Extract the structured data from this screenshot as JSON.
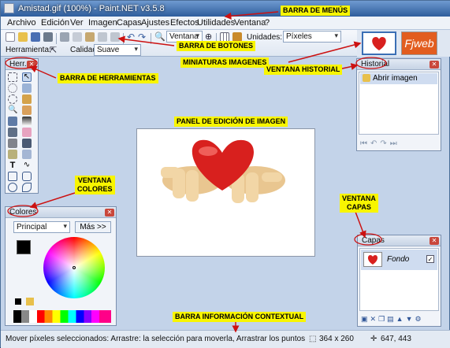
{
  "window": {
    "title": "Amistad.gif (100%) - Paint.NET v3.5.8"
  },
  "menu": [
    "Archivo",
    "Edición",
    "Ver",
    "Imagen",
    "Capas",
    "Ajustes",
    "Efectos",
    "Utilidades",
    "Ventana",
    "?"
  ],
  "toolbar": {
    "zoom_value": "Ventana",
    "units_label": "Unidades:",
    "units_value": "Píxeles",
    "tool_label": "Herramienta:",
    "quality_label": "Calidad:",
    "quality_value": "Suave"
  },
  "thumbnails": {
    "second_label": "Fjweb"
  },
  "tools_panel": {
    "title": "Herr..."
  },
  "history_panel": {
    "title": "Historial",
    "items": [
      "Abrir imagen"
    ]
  },
  "colors_panel": {
    "title": "Colores",
    "palette_select": "Principal",
    "more_button": "Más >>"
  },
  "layers_panel": {
    "title": "Capas",
    "items": [
      {
        "name": "Fondo",
        "visible": true
      }
    ]
  },
  "status": {
    "message": "Mover píxeles seleccionados: Arrastre: la selección para moverla, Arrastrar los puntos de anclaje para graduar el tam",
    "image_size": "364 x 260",
    "cursor_pos": "647, 443"
  },
  "annotations": {
    "menu_bar": "BARRA DE MENÚS",
    "buttons_bar": "BARRA DE BOTONES",
    "thumbnails": "MINIATURAS IMAGENES",
    "history": "VENTANA HISTORIAL",
    "tools": "BARRA DE HERRAMIENTAS",
    "edit_panel": "PANEL DE EDICIÓN DE IMAGEN",
    "colors_1": "VENTANA",
    "colors_2": "COLORES",
    "layers_1": "VENTANA",
    "layers_2": "CAPAS",
    "status": "BARRA INFORMACIÓN CONTEXTUAL"
  },
  "colors": {
    "annotation_bg": "#f8f500",
    "annotation_arrow": "#cc1111",
    "workspace": "#c3d3e9",
    "heart": "#d8201e"
  }
}
